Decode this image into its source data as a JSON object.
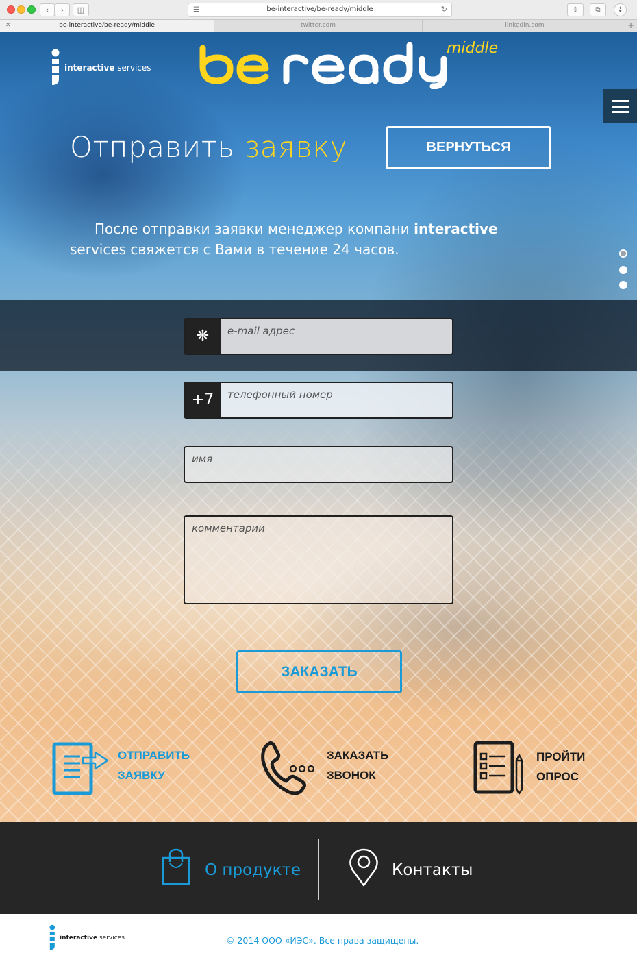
{
  "browser": {
    "url": "be-interactive/be-ready/middle",
    "tabs": [
      {
        "label": "be-interactive/be-ready/middle",
        "active": true
      },
      {
        "label": "twitter.com",
        "active": false
      },
      {
        "label": "linkedin.com",
        "active": false
      }
    ]
  },
  "header": {
    "brand_text_bold": "interactive",
    "brand_text_rest": " services",
    "title_logo": "be ready",
    "title_suffix": "middle",
    "menu_icon": "hamburger-icon"
  },
  "main": {
    "heading_plain": "Отправить ",
    "heading_accent": "заявку",
    "back_button": "ВЕРНУТЬСЯ",
    "info_part1": "После отправки заявки менеджер компани ",
    "info_bold": "interactive",
    "info_part2": " services свяжется с Вами в течение 24 часов.",
    "carousel_dots": 3,
    "form": {
      "email_prefix_icon": "asterisk-icon",
      "email_placeholder": "e-mail адрес",
      "phone_prefix": "+7",
      "phone_placeholder": "телефонный номер",
      "name_placeholder": "имя",
      "comment_placeholder": "комментарии"
    },
    "order_button": "ЗАКАЗАТЬ",
    "actions": [
      {
        "line1": "ОТПРАВИТЬ",
        "line2": "ЗАЯВКУ",
        "icon": "document-send-icon",
        "color": "#1b9ad8"
      },
      {
        "line1": "ЗАКАЗАТЬ",
        "line2": "ЗВОНОК",
        "icon": "phone-icon",
        "color": "#1d1d1d"
      },
      {
        "line1": "ПРОЙТИ",
        "line2": "ОПРОС",
        "icon": "survey-icon",
        "color": "#1d1d1d"
      }
    ]
  },
  "footer_nav": {
    "product": "О продукте",
    "contacts": "Контакты"
  },
  "footer": {
    "brand_text_bold": "interactive",
    "brand_text_rest": " services",
    "copyright": "© 2014 ООО «ИЭС». Все права защищены."
  },
  "colors": {
    "accent_yellow": "#ffd51e",
    "accent_blue": "#1b9ad8",
    "footer_dark": "#262626"
  }
}
